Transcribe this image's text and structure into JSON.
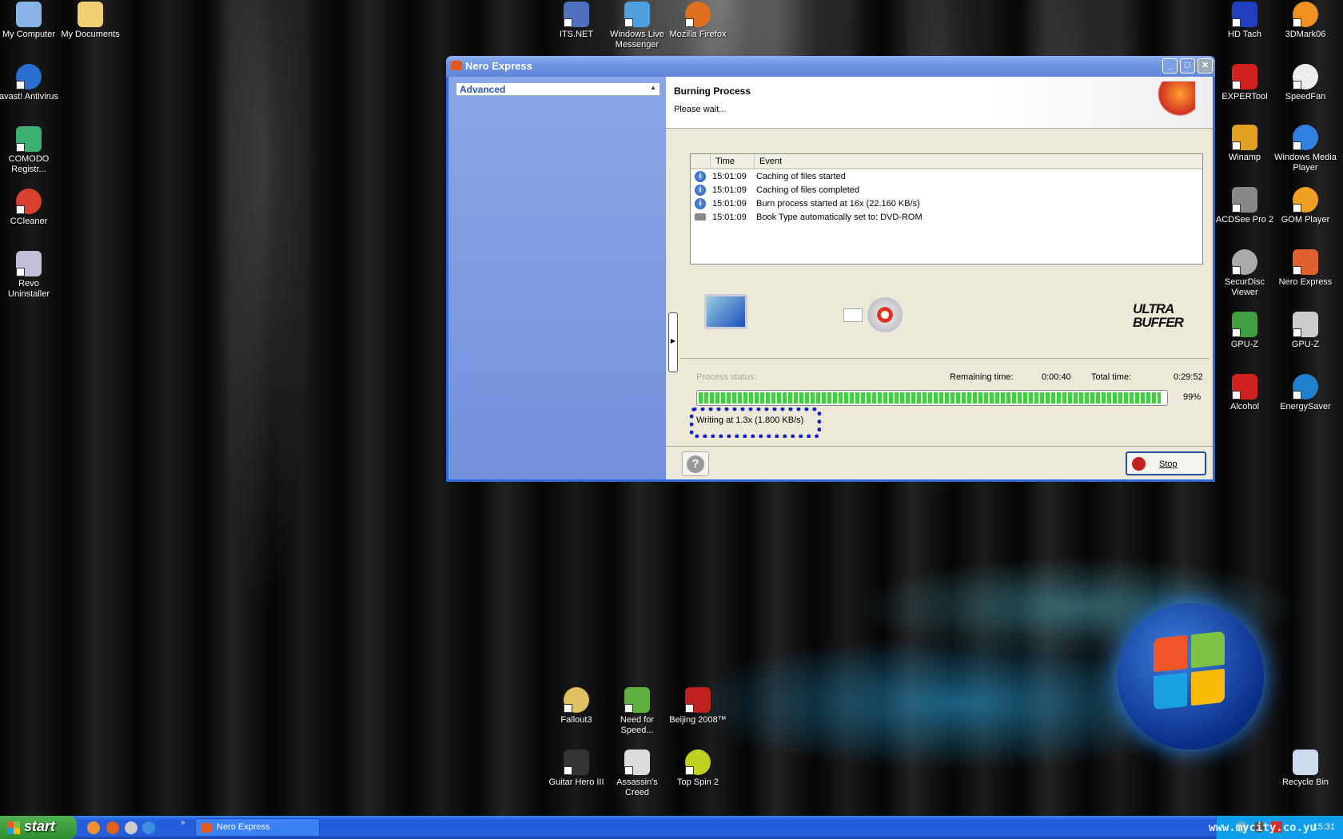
{
  "desktop_icons": [
    "My Computer",
    "My Documents",
    "avast! Antivirus",
    "COMODO Registr...",
    "CCleaner",
    "Revo Uninstaller",
    "ITS.NET",
    "Windows Live Messenger",
    "Mozilla Firefox",
    "HD Tach",
    "3DMark06",
    "EXPERTool",
    "SpeedFan",
    "Winamp",
    "Windows Media Player",
    "ACDSee Pro 2",
    "GOM Player",
    "SecurDisc Viewer",
    "Nero Express",
    "GPU-Z",
    "GPU-Z",
    "Alcohol",
    "EnergySaver",
    "Fallout3",
    "Need for Speed...",
    "Beijing 2008™",
    "Guitar Hero III",
    "Assassin's Creed",
    "Top Spin 2",
    "Recycle Bin"
  ],
  "window": {
    "title": "Nero Express",
    "sidebar_dropdown": "Advanced",
    "header_title": "Burning Process",
    "header_subtitle": "Please wait...",
    "log": {
      "columns": [
        "Time",
        "Event"
      ],
      "rows": [
        {
          "time": "15:01:09",
          "event": "Caching of files started",
          "icon": "info-icon"
        },
        {
          "time": "15:01:09",
          "event": "Caching of files completed",
          "icon": "info-icon"
        },
        {
          "time": "15:01:09",
          "event": "Burn process started at 16x (22.160 KB/s)",
          "icon": "info-icon"
        },
        {
          "time": "15:01:09",
          "event": "Book Type automatically set to: DVD-ROM",
          "icon": "drive-icon"
        }
      ]
    },
    "ultrabuffer_logo": "ULTRA BUFFER",
    "status": {
      "label": "Process status:",
      "remaining_label": "Remaining time:",
      "remaining": "0:00:40",
      "total_label": "Total time:",
      "total": "0:29:52",
      "progress_percent": 99,
      "progress_text": "99%",
      "writing": "Writing at 1.3x (1.800 KB/s)"
    },
    "stop_label": "Stop",
    "help_label": "?"
  },
  "taskbar": {
    "start": "start",
    "task": "Nero Express",
    "clock": "15:31",
    "watermark": "www.mycity.co.yu"
  }
}
